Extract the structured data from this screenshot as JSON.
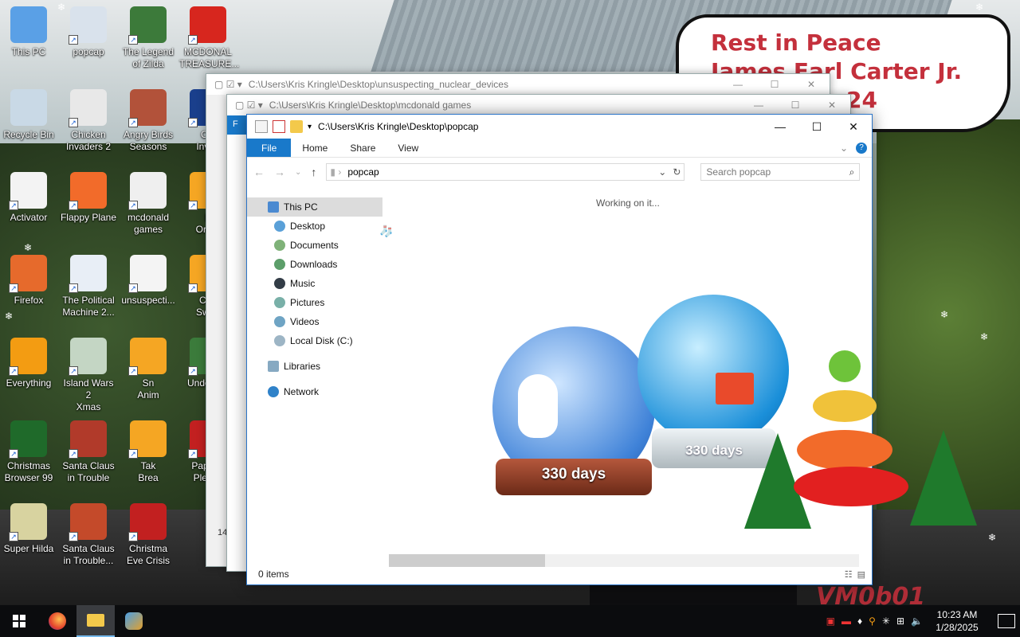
{
  "desktop": {
    "icons": [
      {
        "label": "This PC",
        "label2": ""
      },
      {
        "label": "popcap",
        "label2": ""
      },
      {
        "label": "The Legend",
        "label2": "of Zilda"
      },
      {
        "label": "MCDONAL",
        "label2": "TREASURE..."
      },
      {
        "label": "Recycle Bin",
        "label2": ""
      },
      {
        "label": "Chicken",
        "label2": "Invaders 2"
      },
      {
        "label": "Angry Birds",
        "label2": "Seasons"
      },
      {
        "label": "Chi",
        "label2": "Invad"
      },
      {
        "label": "Activator",
        "label2": ""
      },
      {
        "label": "Flappy Plane",
        "label2": ""
      },
      {
        "label": "mcdonald",
        "label2": "games"
      },
      {
        "label": "B",
        "label2": "Ornar"
      },
      {
        "label": "Firefox",
        "label2": ""
      },
      {
        "label": "The Political",
        "label2": "Machine 2..."
      },
      {
        "label": "unsuspecti...",
        "label2": ""
      },
      {
        "label": "Chri",
        "label2": "Swee"
      },
      {
        "label": "Everything",
        "label2": ""
      },
      {
        "label": "Island Wars 2",
        "label2": "Xmas"
      },
      {
        "label": "Sn",
        "label2": "Anim"
      },
      {
        "label": "Undertale",
        "label2": ""
      },
      {
        "label": "Christmas",
        "label2": "Browser 99"
      },
      {
        "label": "Santa Claus",
        "label2": "in Trouble"
      },
      {
        "label": "Tak",
        "label2": "Brea"
      },
      {
        "label": "Papers,",
        "label2": "Please"
      },
      {
        "label": "Super Hilda",
        "label2": ""
      },
      {
        "label": "Santa Claus",
        "label2": "in Trouble..."
      },
      {
        "label": "Christma",
        "label2": "Eve Crisis"
      }
    ]
  },
  "bubble": {
    "line1": "Rest in Peace",
    "line2": "James Earl Carter Jr.",
    "line3": "24"
  },
  "watermark": "VM0b01",
  "back_windows": [
    {
      "path": "C:\\Users\\Kris Kringle\\Desktop\\unsuspecting_nuclear_devices",
      "partial1": "F",
      "partial2": "14",
      "partial3": "7"
    },
    {
      "path": "C:\\Users\\Kris Kringle\\Desktop\\mcdonald games",
      "partial1": "F"
    }
  ],
  "window": {
    "path": "C:\\Users\\Kris Kringle\\Desktop\\popcap",
    "tabs": {
      "file": "File",
      "home": "Home",
      "share": "Share",
      "view": "View"
    },
    "address": "popcap",
    "search_placeholder": "Search popcap",
    "working": "Working on it...",
    "status": "0 items",
    "nav": {
      "this_pc": "This PC",
      "desktop": "Desktop",
      "documents": "Documents",
      "downloads": "Downloads",
      "music": "Music",
      "pictures": "Pictures",
      "videos": "Videos",
      "local_disk": "Local Disk (C:)",
      "libraries": "Libraries",
      "network": "Network"
    }
  },
  "globes": {
    "label1": "330 days",
    "label2": "330 days"
  },
  "taskbar": {
    "time": "10:23 AM",
    "date": "1/28/2025"
  },
  "colors": {
    "accent": "#1979ca",
    "bubble_text": "#c4303c",
    "taskbar": "#0b0c0e"
  }
}
